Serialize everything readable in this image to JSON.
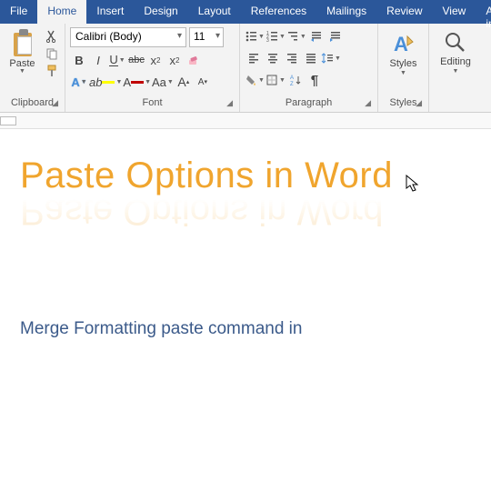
{
  "tabs": {
    "file": "File",
    "home": "Home",
    "insert": "Insert",
    "design": "Design",
    "layout": "Layout",
    "references": "References",
    "mailings": "Mailings",
    "review": "Review",
    "view": "View",
    "addins": "Add-ins"
  },
  "clipboard": {
    "paste": "Paste",
    "group_label": "Clipboard"
  },
  "font": {
    "name": "Calibri (Body)",
    "size": "11",
    "bold": "B",
    "italic": "I",
    "underline": "U",
    "strike": "abc",
    "sub": "x",
    "sup": "x",
    "highlight": "A",
    "fontcolor": "A",
    "case": "Aa",
    "grow": "A",
    "shrink": "A",
    "group_label": "Font"
  },
  "paragraph": {
    "group_label": "Paragraph"
  },
  "styles": {
    "label": "Styles",
    "group_label": "Styles"
  },
  "editing": {
    "label": "Editing"
  },
  "document": {
    "title": "Paste Options in Word",
    "body": "Merge Formatting paste command in"
  },
  "colors": {
    "accent": "#2b579a",
    "title": "#f0a52e",
    "body": "#3b5a8a",
    "highlight": "#ffff00",
    "fontcolor": "#c00000"
  }
}
